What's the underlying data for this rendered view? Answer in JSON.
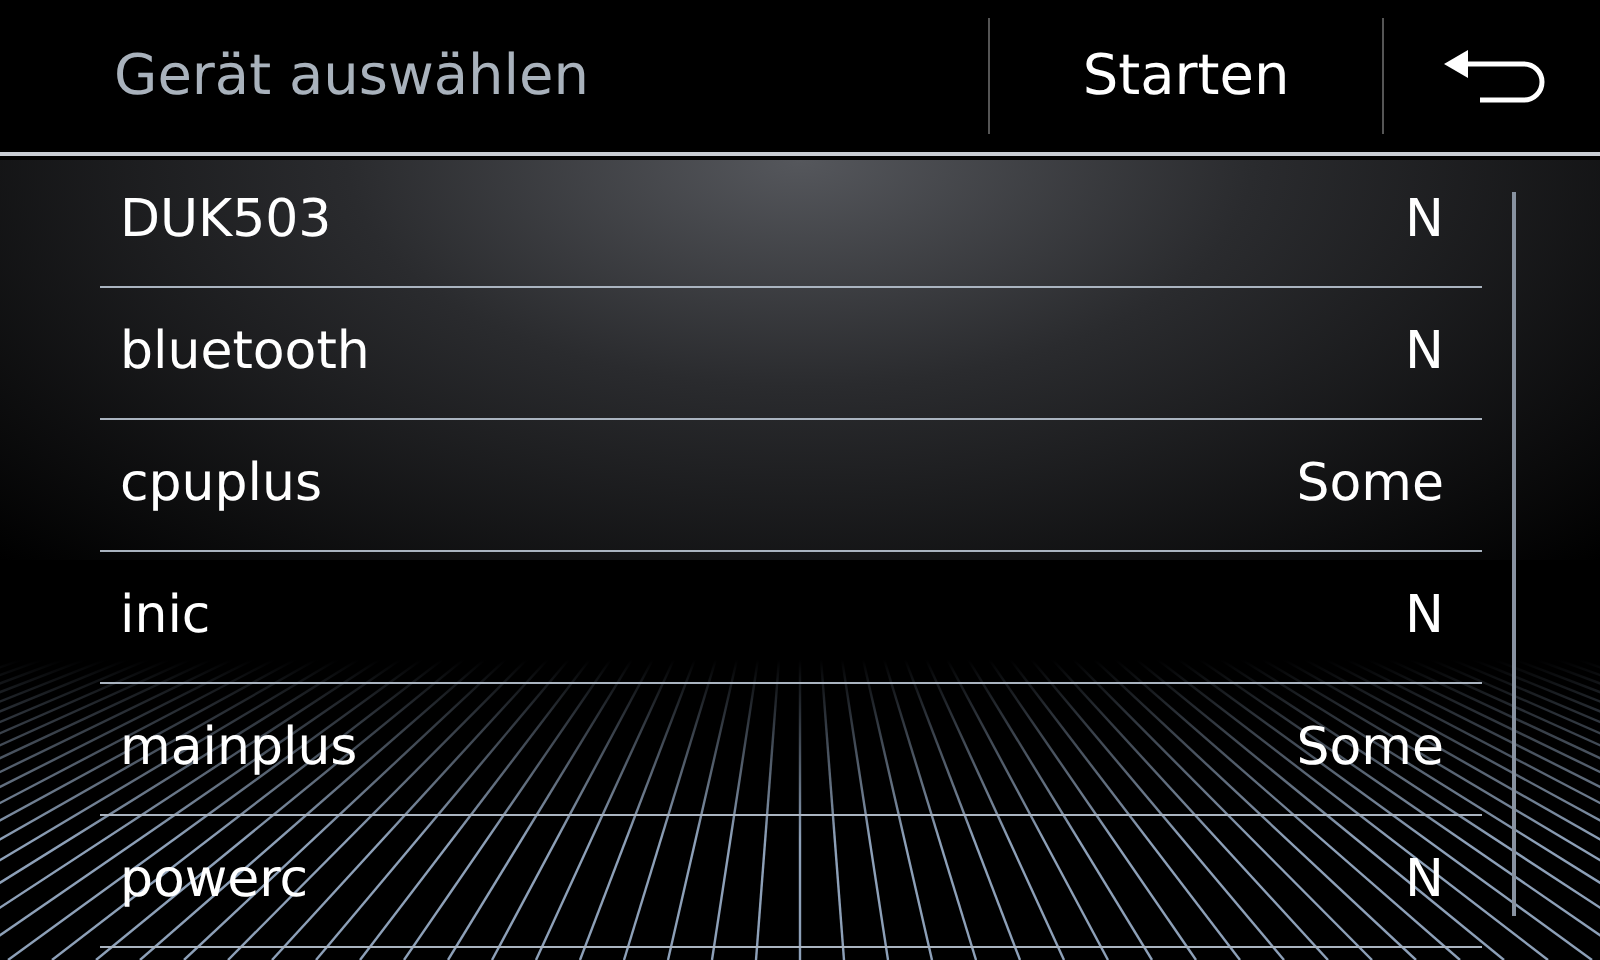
{
  "header": {
    "title": "Gerät auswählen",
    "start_button": "Starten"
  },
  "devices": [
    {
      "name": "DUK503",
      "value": "N"
    },
    {
      "name": "bluetooth",
      "value": "N"
    },
    {
      "name": "cpuplus",
      "value": "Some"
    },
    {
      "name": "inic",
      "value": "N"
    },
    {
      "name": "mainplus",
      "value": "Some"
    },
    {
      "name": "powerc",
      "value": "N"
    }
  ]
}
